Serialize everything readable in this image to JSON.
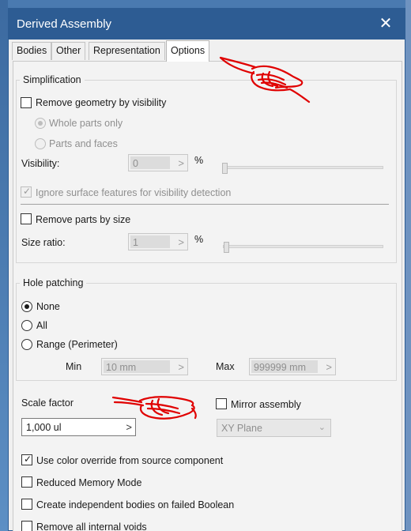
{
  "window": {
    "title": "Derived Assembly",
    "close_icon": "close-icon"
  },
  "tabs": [
    {
      "label": "Bodies",
      "active": false
    },
    {
      "label": "Other",
      "active": false
    },
    {
      "label": "Representation",
      "active": false
    },
    {
      "label": "Options",
      "active": true
    }
  ],
  "simplification": {
    "title": "Simplification",
    "remove_by_visibility": {
      "label": "Remove geometry by visibility",
      "checked": false
    },
    "whole_parts": {
      "label": "Whole parts only",
      "selected": true,
      "enabled": false
    },
    "parts_faces": {
      "label": "Parts and faces",
      "selected": false,
      "enabled": false
    },
    "visibility": {
      "label": "Visibility:",
      "value": "0",
      "unit": "%"
    },
    "ignore_surface": {
      "label": "Ignore surface features for visibility detection",
      "checked": true,
      "enabled": false
    },
    "remove_by_size": {
      "label": "Remove parts by size",
      "checked": false
    },
    "size_ratio": {
      "label": "Size ratio:",
      "value": "1",
      "unit": "%"
    }
  },
  "hole_patching": {
    "title": "Hole patching",
    "options": [
      {
        "label": "None",
        "selected": true
      },
      {
        "label": "All",
        "selected": false
      },
      {
        "label": "Range (Perimeter)",
        "selected": false
      }
    ],
    "min": {
      "label": "Min",
      "value": "10 mm"
    },
    "max": {
      "label": "Max",
      "value": "999999 mm"
    }
  },
  "scale": {
    "label": "Scale factor",
    "value": "1,000 ul",
    "arrow": ">"
  },
  "mirror": {
    "label": "Mirror assembly",
    "checked": false,
    "plane": "XY Plane"
  },
  "checkboxes": [
    {
      "label": "Use color override from source component",
      "checked": true
    },
    {
      "label": "Reduced Memory Mode",
      "checked": false
    },
    {
      "label": "Create independent bodies on failed Boolean",
      "checked": false
    },
    {
      "label": "Remove all internal voids",
      "checked": false
    }
  ],
  "glyphs": {
    "check": "✓",
    "arrow": ">",
    "chevron": "⌄",
    "close": "✕"
  },
  "colors": {
    "titlebar": "#2d5c93",
    "annotation": "#e00000"
  }
}
